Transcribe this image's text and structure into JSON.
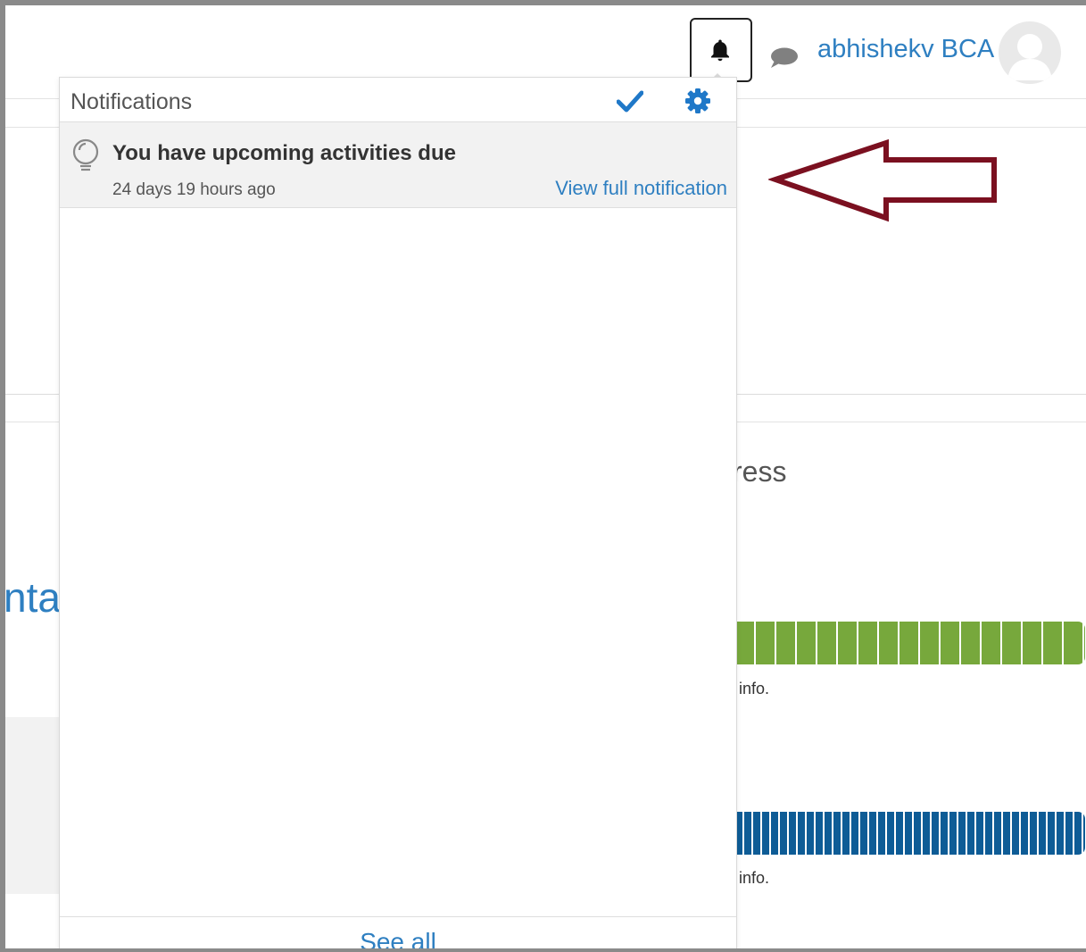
{
  "navbar": {
    "user_name": "abhishekv BCA"
  },
  "notifications": {
    "title": "Notifications",
    "items": [
      {
        "text": "You have upcoming activities due",
        "time": "24 days 19 hours ago",
        "link": "View full notification"
      }
    ],
    "see_all": "See all"
  },
  "background": {
    "progress_title_partial": "ress",
    "left_heading_partial": "nta",
    "bars": [
      {
        "color": "#77a83c",
        "info_partial": "info."
      },
      {
        "color": "#0e5c96",
        "info_partial": "info."
      }
    ]
  },
  "icons": {
    "bell": "bell-icon",
    "messages": "speech-bubble-icon",
    "mark_read": "check-icon",
    "settings": "gear-icon",
    "notification_type": "lightbulb-icon"
  },
  "colors": {
    "link_blue": "#2e7fc1",
    "annotation_arrow": "#7b1020"
  }
}
